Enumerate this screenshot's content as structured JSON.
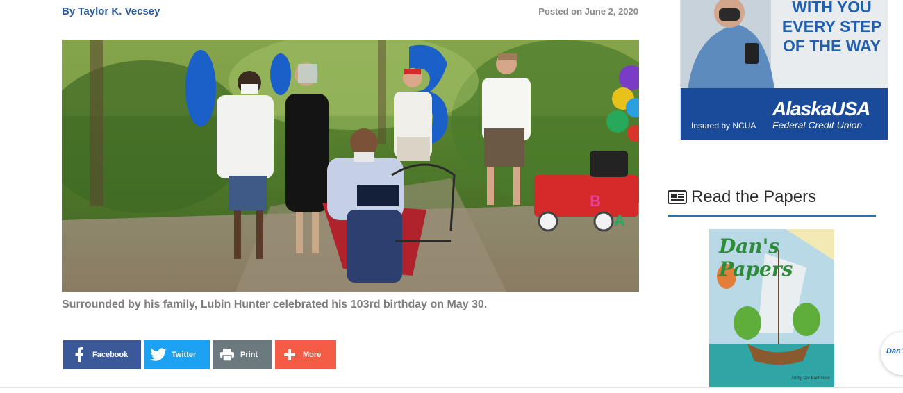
{
  "article": {
    "byline": "By Taylor K. Vecsey",
    "posted": "Posted on June 2, 2020",
    "caption": "Surrounded by his family, Lubin Hunter celebrated his 103rd birthday on May 30."
  },
  "share": [
    {
      "label": "Facebook",
      "icon": "facebook-icon",
      "color": "#3b5998"
    },
    {
      "label": "Twitter",
      "icon": "twitter-icon",
      "color": "#1da1f2"
    },
    {
      "label": "Print",
      "icon": "print-icon",
      "color": "#6c7a7f"
    },
    {
      "label": "More",
      "icon": "plus-icon",
      "color": "#f45c45"
    }
  ],
  "ad": {
    "headline_lines": [
      "WITH YOU",
      "EVERY STEP",
      "OF THE WAY"
    ],
    "ncua": "Insured by NCUA",
    "logo": "AlaskaUSA",
    "logo_sub": "Federal Credit Union",
    "brand_color": "#1a4b9a"
  },
  "sidebar": {
    "papers_title": "Read the Papers",
    "papers_icon": "newspaper-icon",
    "cover_brand": "Dan's Papers",
    "cover_credit": "Art by Cor Bashmeer"
  },
  "floating": {
    "label": "Dan's"
  }
}
